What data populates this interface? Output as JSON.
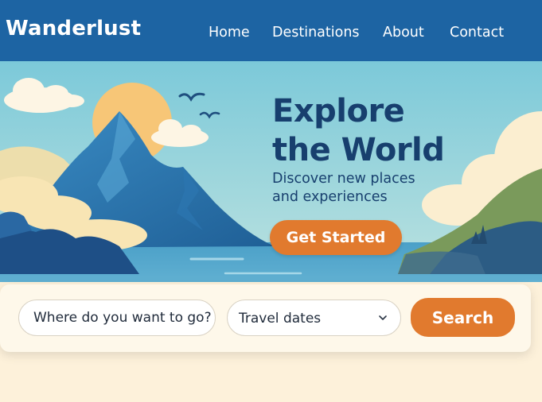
{
  "header": {
    "brand": "Wanderlust",
    "nav": [
      {
        "label": "Home"
      },
      {
        "label": "Destinations"
      },
      {
        "label": "About"
      },
      {
        "label": "Contact"
      }
    ]
  },
  "hero": {
    "title_line1": "Explore",
    "title_line2": "the World",
    "subtitle_line1": "Discover new places",
    "subtitle_line2": "and experiences",
    "cta_label": "Get Started"
  },
  "search": {
    "destination_placeholder": "Where do you want to go?",
    "dates_label": "Travel dates",
    "button_label": "Search"
  },
  "colors": {
    "nav_bg": "#1d64a3",
    "accent": "#e17a2e",
    "headline": "#173f6e",
    "card_bg": "#fef8ea"
  }
}
